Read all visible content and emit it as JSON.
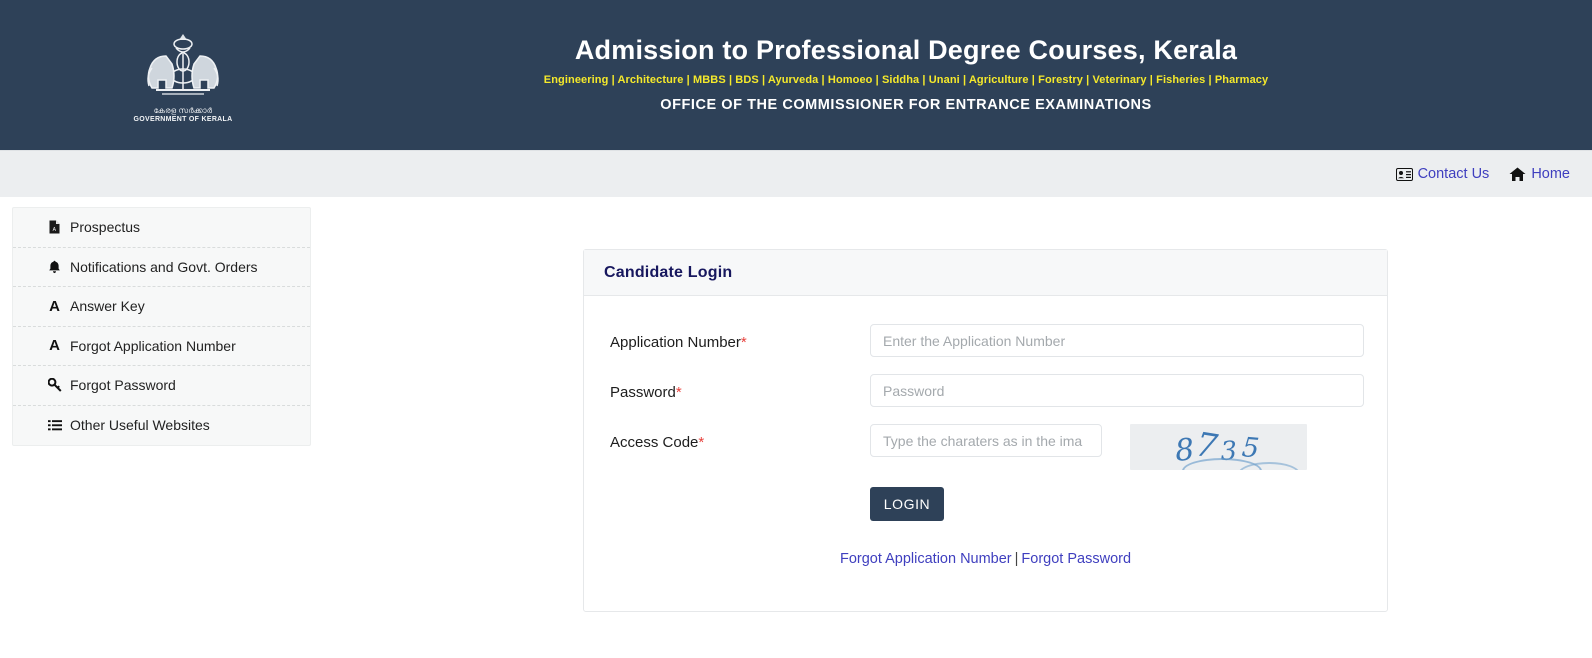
{
  "header": {
    "title": "Admission to Professional Degree Courses, Kerala",
    "courses": "Engineering | Architecture | MBBS | BDS | Ayurveda | Homoeo | Siddha | Unani | Agriculture | Forestry | Veterinary | Fisheries | Pharmacy",
    "office": "OFFICE OF THE COMMISSIONER FOR ENTRANCE EXAMINATIONS",
    "emblem": {
      "icon": "kerala-government-emblem",
      "malayalam_text": "കേരള സർക്കാർ",
      "english_text": "GOVERNMENT OF KERALA"
    },
    "bg_color": "#2e4158",
    "courses_color": "#f5e92b"
  },
  "navbar": {
    "bg_color": "#eceef0",
    "link_color": "#3f3fbf",
    "items": [
      {
        "label": "Contact Us",
        "icon": "id-card-icon"
      },
      {
        "label": "Home",
        "icon": "home-icon"
      }
    ]
  },
  "sidebar": {
    "items": [
      {
        "label": "Prospectus",
        "icon": "pdf-file-icon"
      },
      {
        "label": "Notifications and Govt. Orders",
        "icon": "bell-icon"
      },
      {
        "label": "Answer Key",
        "icon": "letter-a-icon"
      },
      {
        "label": "Forgot Application Number",
        "icon": "letter-a-icon"
      },
      {
        "label": "Forgot Password",
        "icon": "key-icon"
      },
      {
        "label": "Other Useful Websites",
        "icon": "list-icon"
      }
    ]
  },
  "login_card": {
    "title": "Candidate Login",
    "title_color": "#17175e",
    "required_mark": "*",
    "fields": [
      {
        "label": "Application Number",
        "placeholder": "Enter the Application Number",
        "value": ""
      },
      {
        "label": "Password",
        "placeholder": "Password",
        "value": ""
      },
      {
        "label": "Access Code",
        "placeholder": "Type the charaters as in the ima",
        "value": ""
      }
    ],
    "captcha": {
      "icon": "captcha-image",
      "text": "8735",
      "digits": [
        "8",
        "7",
        "3",
        "5"
      ],
      "bg_color": "#eceef0",
      "text_color": "#3d78b4"
    },
    "submit_label": "LOGIN",
    "submit_color": "#2e4158",
    "helper": {
      "forgot_application_number": "Forgot Application Number",
      "separator": "|",
      "forgot_password": "Forgot Password"
    }
  }
}
